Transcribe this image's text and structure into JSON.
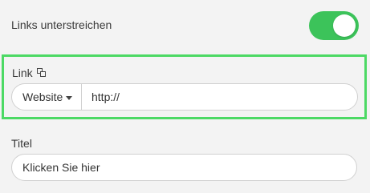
{
  "underline_links": {
    "label": "Links unterstreichen",
    "enabled": true,
    "accent_color": "#3cc35a"
  },
  "link": {
    "label": "Link",
    "copy_icon": "copy-icon",
    "type_select": {
      "selected": "Website",
      "icon": "caret-down-icon"
    },
    "url_value": "http://"
  },
  "title": {
    "label": "Titel",
    "value": "Klicken Sie hier"
  },
  "highlight_color": "#4cd964"
}
